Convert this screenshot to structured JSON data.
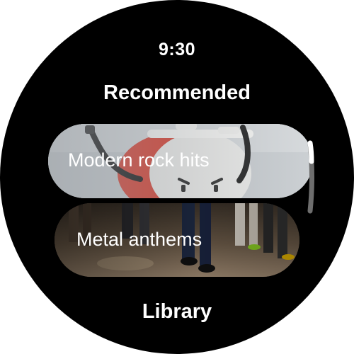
{
  "status": {
    "time": "9:30"
  },
  "recommended": {
    "title": "Recommended",
    "items": [
      {
        "label": "Modern rock hits"
      },
      {
        "label": "Metal anthems"
      }
    ]
  },
  "library": {
    "label": "Library"
  },
  "icons": {
    "scroll": "scroll-indicator-icon"
  },
  "colors": {
    "face_background": "#000000",
    "text": "#ffffff",
    "scroll_thumb": "#ffffff",
    "scroll_track": "#6e6e6e"
  }
}
